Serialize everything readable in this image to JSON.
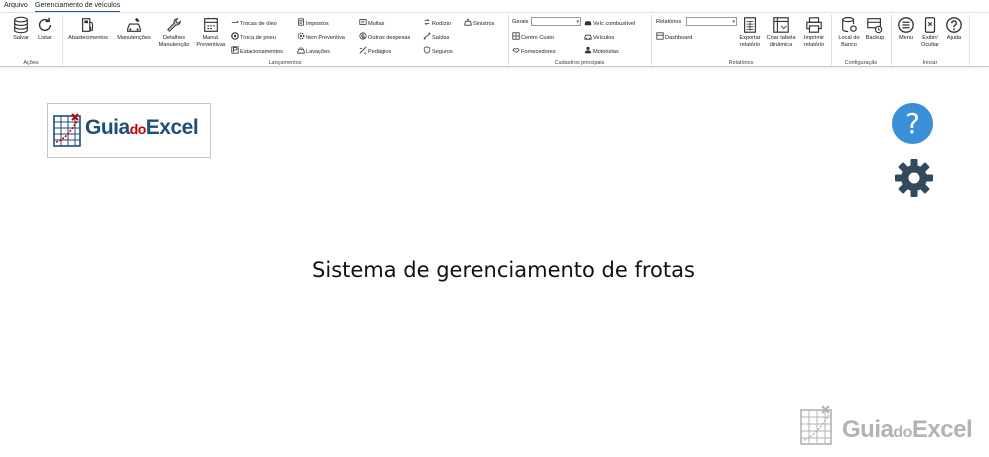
{
  "menu": {
    "tabs": [
      {
        "label": "Arquivo"
      },
      {
        "label": "Gerenciamento de veículos"
      }
    ]
  },
  "ribbon": {
    "groups": {
      "acoes": {
        "label": "Ações",
        "salvar": "Salvar",
        "listar": "Listar"
      },
      "lancamentos": {
        "label": "Lançamentos",
        "abastecimentos": "Abastecimentos",
        "manutencoes": "Manutenções",
        "detalhes_l1": "Detalhes",
        "detalhes_l2": "Manutenção",
        "manut_l1": "Manut.",
        "manut_l2": "Preventivas",
        "trocas_oleo": "Trocas de óleo",
        "troca_pneu": "Troca de pneu",
        "estacionamentos": "Estacionamentos",
        "impostos": "Impostos",
        "item_preventiva": "Item Preventiva",
        "lavacoes": "Lavações",
        "multas": "Multas",
        "outras_despesas": "Outras despesas",
        "pedagios": "Pedágios",
        "rodizio": "Rodízio",
        "saidas": "Saídas",
        "seguros": "Seguros",
        "sinistros": "Sinistros"
      },
      "cadastros": {
        "label": "Cadastros principais",
        "gerais": "Gerais",
        "gerais_value": "",
        "centro_custo": "Centro Custo",
        "fornecedores": "Fornecedores",
        "veic_combustivel": "Veíc combustível",
        "veiculos": "Veículos",
        "motoristas": "Motoristas"
      },
      "relatorios": {
        "label": "Relatórios",
        "relatorios_combo_label": "Relatórios",
        "relatorios_value": "",
        "dashboard": "Dashboard",
        "exportar_l1": "Exportar",
        "exportar_l2": "relatório",
        "criar_l1": "Criar tabela",
        "criar_l2": "dinâmica",
        "imprimir_l1": "Imprimir",
        "imprimir_l2": "relatório"
      },
      "configuracao": {
        "label": "Configuração",
        "local_l1": "Local do",
        "local_l2": "Banco",
        "backup": "Backup"
      },
      "iniciar": {
        "label": "Iniciar",
        "menu": "Menu",
        "exibir_l1": "Exibir/",
        "exibir_l2": "Ocultar",
        "ajuda": "Ajuda"
      }
    }
  },
  "main": {
    "logo": {
      "part1": "Guia",
      "part2": "do",
      "part3": "Excel"
    },
    "help_glyph": "?",
    "title": "Sistema de gerenciamento de frotas",
    "watermark": {
      "part1": "Guia",
      "part2": "do",
      "part3": "Excel"
    }
  },
  "colors": {
    "help_button": "#3b8fd6",
    "gear_icon": "#34495e",
    "logo_blue": "#1f4e79",
    "logo_red": "#c00000",
    "watermark_gray": "#b3b3b3"
  }
}
